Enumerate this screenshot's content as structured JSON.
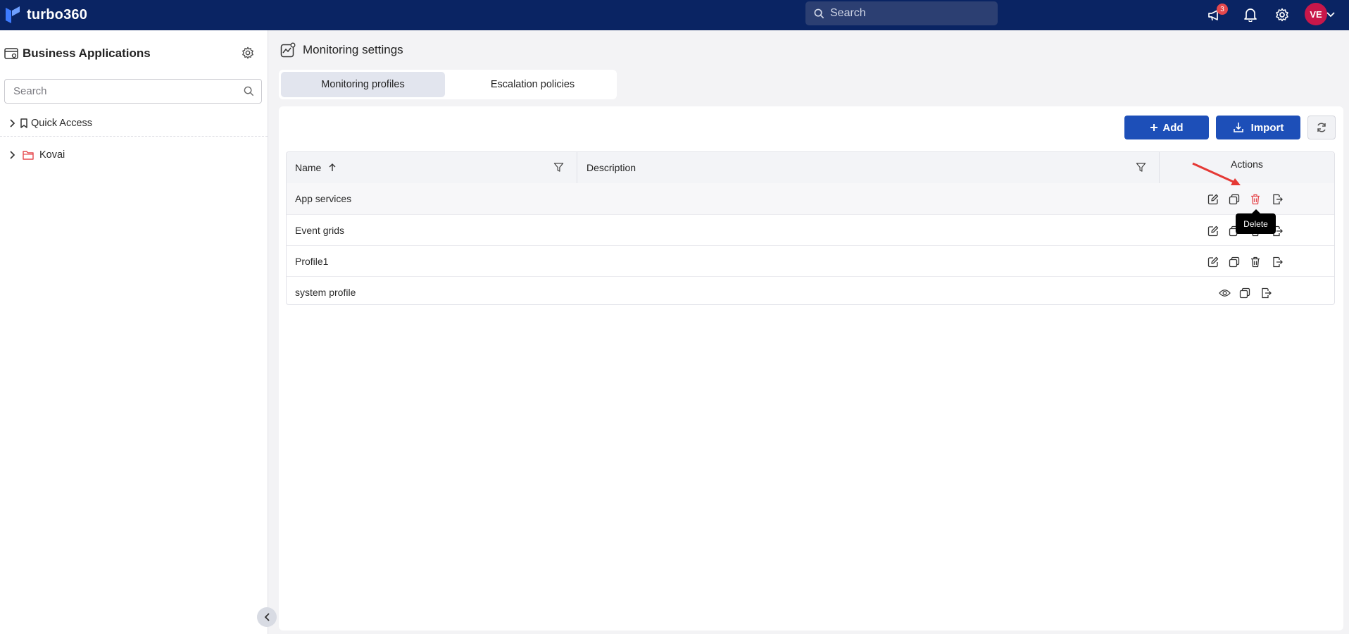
{
  "app": {
    "brand": "turbo360",
    "brand_color": "#0a2463",
    "accent": "#1d4fb8"
  },
  "topbar": {
    "search_placeholder": "Search",
    "announcements_count": "3",
    "icons": [
      "megaphone-icon",
      "bell-icon",
      "gear-icon"
    ],
    "user_initials": "VE"
  },
  "sidebar": {
    "title": "Business Applications",
    "search_placeholder": "Search",
    "items": [
      {
        "label": "Quick Access",
        "icon": "bookmark-icon"
      },
      {
        "label": "Kovai",
        "icon": "folder-icon"
      }
    ]
  },
  "main": {
    "title": "Monitoring settings",
    "tabs": [
      {
        "label": "Monitoring profiles",
        "active": true
      },
      {
        "label": "Escalation policies",
        "active": false
      }
    ],
    "buttons": {
      "add": "Add",
      "import": "Import"
    },
    "table": {
      "columns": {
        "name": "Name",
        "description": "Description",
        "actions": "Actions"
      },
      "sort": "ascending",
      "rows": [
        {
          "name": "App services",
          "description": "",
          "actions": [
            "edit",
            "copy",
            "delete",
            "export"
          ]
        },
        {
          "name": "Event grids",
          "description": "",
          "actions": [
            "edit",
            "copy",
            "delete",
            "export"
          ]
        },
        {
          "name": "Profile1",
          "description": "",
          "actions": [
            "edit",
            "copy",
            "delete",
            "export"
          ]
        },
        {
          "name": "system profile",
          "description": "",
          "actions": [
            "view",
            "copy",
            "export"
          ]
        }
      ]
    },
    "tooltip": "Delete"
  }
}
